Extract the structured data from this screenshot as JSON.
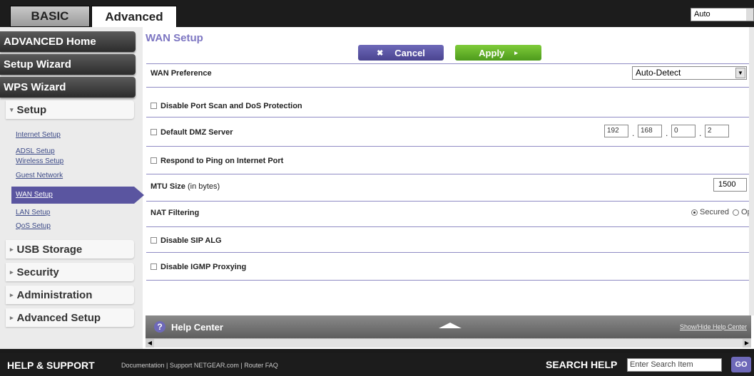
{
  "tabs": {
    "basic": "BASIC",
    "advanced": "Advanced"
  },
  "language": {
    "selected": "Auto"
  },
  "sidebar": {
    "main_items": [
      "ADVANCED Home",
      "Setup Wizard",
      "WPS Wizard"
    ],
    "setup": "Setup",
    "setup_items": [
      "Internet Setup",
      "ADSL Setup",
      "Wireless Setup",
      "Guest Network",
      "WAN Setup",
      "LAN Setup",
      "QoS Setup"
    ],
    "sections": [
      "USB Storage",
      "Security",
      "Administration",
      "Advanced Setup"
    ]
  },
  "page": {
    "title": "WAN Setup",
    "cancel": "Cancel",
    "apply": "Apply"
  },
  "form": {
    "wan_preference_label": "WAN Preference",
    "wan_preference_value": "Auto-Detect",
    "disable_port_scan": "Disable Port Scan and DoS Protection",
    "default_dmz": "Default DMZ Server",
    "dmz_ip": [
      "192",
      "168",
      "0",
      "2"
    ],
    "respond_ping": "Respond to Ping on Internet Port",
    "mtu_label": "MTU Size",
    "mtu_unit": "(in bytes)",
    "mtu_value": "1500",
    "nat_label": "NAT Filtering",
    "nat_secured": "Secured",
    "nat_open": "Open",
    "nat_selected": "Secured",
    "disable_sip": "Disable SIP ALG",
    "disable_igmp": "Disable IGMP Proxying"
  },
  "help": {
    "title": "Help Center",
    "toggle": "Show/Hide Help Center"
  },
  "footer": {
    "help_support": "HELP & SUPPORT",
    "links": [
      "Documentation",
      "Support NETGEAR.com",
      "Router FAQ"
    ],
    "search_label": "SEARCH HELP",
    "search_placeholder": "Enter Search Item",
    "go": "GO"
  }
}
